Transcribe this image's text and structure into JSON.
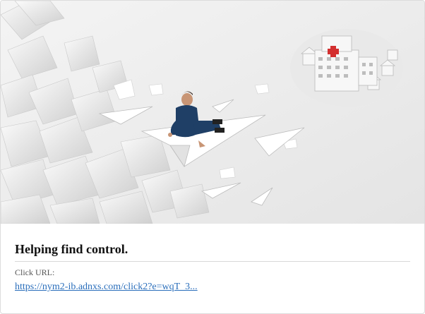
{
  "ad": {
    "title": "Helping find control.",
    "click_label": "Click URL:",
    "click_url": "https://nym2-ib.adnxs.com/click2?e=wqT_3..."
  }
}
